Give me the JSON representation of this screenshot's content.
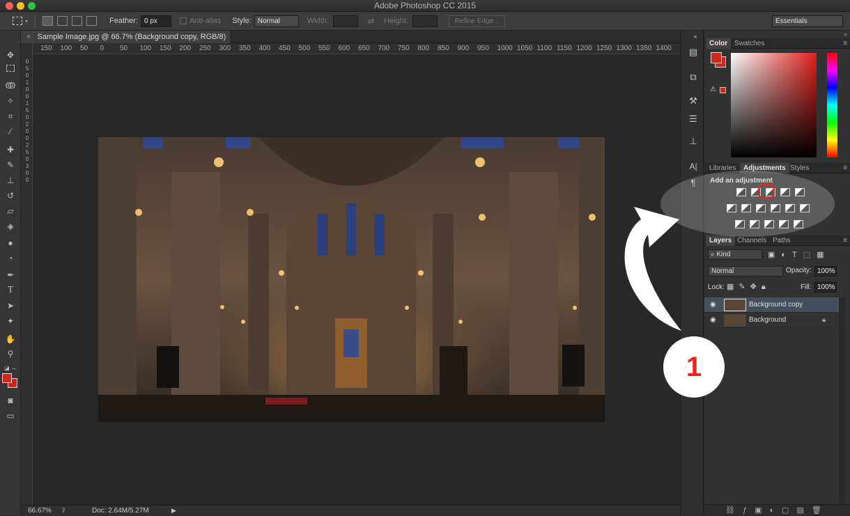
{
  "app": {
    "title": "Adobe Photoshop CC 2015"
  },
  "options_bar": {
    "feather_label": "Feather:",
    "feather_value": "0 px",
    "antialias_label": "Anti-alias",
    "style_label": "Style:",
    "style_value": "Normal",
    "width_label": "Width:",
    "height_label": "Height:",
    "refine_edge_label": "Refine Edge...",
    "workspace_value": "Essentials"
  },
  "document": {
    "tab_label": "Sample Image.jpg @ 66.7% (Background copy, RGB/8) *",
    "ruler_h": [
      "150",
      "100",
      "50",
      "0",
      "50",
      "100",
      "150",
      "200",
      "250",
      "300",
      "350",
      "400",
      "450",
      "500",
      "550",
      "600",
      "650",
      "700",
      "750",
      "800",
      "850",
      "900",
      "950",
      "1000",
      "1050",
      "1100",
      "1150",
      "1200",
      "1250",
      "1300",
      "1350",
      "1400"
    ],
    "ruler_v": [
      "0",
      "5",
      "0",
      "1",
      "0",
      "0",
      "1",
      "5",
      "0",
      "2",
      "0",
      "0",
      "2",
      "5",
      "0",
      "3",
      "0",
      "0"
    ]
  },
  "status": {
    "zoom": "66.67%",
    "doc_info": "Doc: 2.64M/5.27M"
  },
  "color_panel": {
    "tabs": [
      "Color",
      "Swatches"
    ],
    "fg_color": "#d3261a",
    "bg_color": "#d3261a"
  },
  "adjustments_panel": {
    "tabs": [
      "Libraries",
      "Adjustments",
      "Styles"
    ],
    "heading": "Add an adjustment",
    "icons": [
      "brightness-contrast-icon",
      "levels-icon",
      "curves-icon",
      "exposure-icon",
      "vibrance-icon",
      "hue-saturation-icon",
      "color-balance-icon",
      "black-white-icon",
      "photo-filter-icon",
      "channel-mixer-icon",
      "color-lookup-icon",
      "invert-icon",
      "posterize-icon",
      "threshold-icon",
      "gradient-map-icon",
      "selective-color-icon"
    ]
  },
  "layers_panel": {
    "tabs": [
      "Layers",
      "Channels",
      "Paths"
    ],
    "kind_label": "Kind",
    "blend_mode": "Normal",
    "opacity_label": "Opacity:",
    "opacity_value": "100%",
    "lock_label": "Lock:",
    "fill_label": "Fill:",
    "fill_value": "100%",
    "layers": [
      {
        "name": "Background copy",
        "selected": true,
        "locked": false
      },
      {
        "name": "Background",
        "selected": false,
        "locked": true
      }
    ]
  },
  "annotation": {
    "step_number": "1",
    "accent": "#e8261c"
  }
}
